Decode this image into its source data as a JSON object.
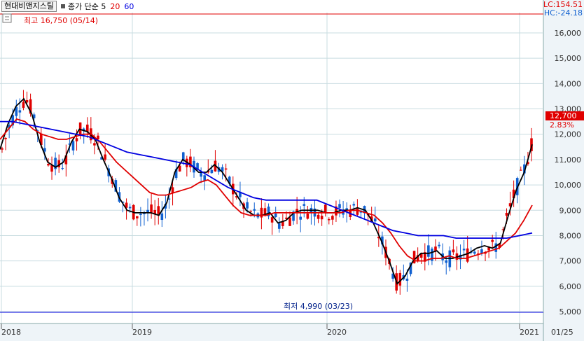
{
  "header": {
    "stock_name": "현대비앤지스틸",
    "ma_label": "종가 단순 5",
    "ma20": "20",
    "ma60": "60"
  },
  "indicators": {
    "lc": "LC:154.51",
    "hc": "HC:-24.18"
  },
  "annotations": {
    "high": "최고 16,750 (05/14)",
    "low": "최저 4,990 (03/23)",
    "last_price": "12,700",
    "change_pct": "2.83%"
  },
  "colors": {
    "up": "#e00000",
    "down": "#1060d0",
    "ma5": "#000000",
    "ma20": "#e00000",
    "ma60": "#0000e0",
    "grid": "#c8dce0"
  },
  "chart_data": {
    "type": "line",
    "ylim": [
      4900,
      16800
    ],
    "yticks": [
      5000,
      6000,
      7000,
      8000,
      9000,
      10000,
      11000,
      12000,
      13000,
      14000,
      15000,
      16000
    ],
    "ytick_labels": [
      "5,000",
      "6,000",
      "7,000",
      "8,000",
      "9,000",
      "10,000",
      "11,000",
      "12,000",
      "13,000",
      "14,000",
      "15,000",
      "16,000"
    ],
    "xtick_labels": [
      "2018",
      "2019",
      "2020",
      "2021",
      "01/25"
    ],
    "high_value": 16750,
    "low_value": 4990,
    "last_value": 12700,
    "series": [
      {
        "name": "5",
        "color": "#000000",
        "values": [
          11400,
          12400,
          13100,
          13400,
          12800,
          11700,
          10900,
          10700,
          10900,
          11700,
          12200,
          12100,
          11800,
          11000,
          10300,
          9500,
          9000,
          8900,
          8900,
          8900,
          8800,
          9300,
          10500,
          11000,
          10800,
          10500,
          10500,
          10800,
          10500,
          10000,
          9500,
          9000,
          8800,
          8800,
          8900,
          8500,
          8600,
          8900,
          9000,
          9000,
          9000,
          8900,
          8900,
          9000,
          9000,
          9100,
          9000,
          8500,
          7800,
          7000,
          6100,
          6400,
          7000,
          7300,
          7300,
          7400,
          7100,
          7100,
          7200,
          7300,
          7500,
          7600,
          7500,
          7700,
          8800,
          9800,
          10500,
          11600
        ]
      },
      {
        "name": "20",
        "color": "#e00000",
        "values": [
          11800,
          12200,
          12600,
          12500,
          12200,
          12000,
          11900,
          11800,
          11800,
          11900,
          12000,
          12000,
          11700,
          11300,
          10900,
          10600,
          10300,
          10000,
          9700,
          9600,
          9600,
          9700,
          9800,
          9900,
          10100,
          10200,
          10000,
          9600,
          9200,
          8900,
          8800,
          8800,
          8800,
          8900,
          8900,
          8900,
          8900,
          8900,
          8900,
          8900,
          8900,
          8900,
          9000,
          9000,
          8900,
          8800,
          8500,
          8100,
          7600,
          7200,
          7000,
          7000,
          7100,
          7100,
          7200,
          7100,
          7100,
          7200,
          7300,
          7400,
          7500,
          7800,
          8100,
          8600,
          9200
        ]
      },
      {
        "name": "60",
        "color": "#0000e0",
        "values": [
          12500,
          12500,
          12400,
          12300,
          12200,
          12100,
          12000,
          11900,
          11700,
          11500,
          11300,
          11200,
          11100,
          11000,
          10900,
          10800,
          10500,
          10200,
          9900,
          9700,
          9500,
          9400,
          9400,
          9400,
          9400,
          9400,
          9200,
          9000,
          8800,
          8600,
          8400,
          8200,
          8100,
          8000,
          8000,
          8000,
          7900,
          7900,
          7900,
          7900,
          7900,
          8000,
          8100
        ]
      }
    ]
  }
}
